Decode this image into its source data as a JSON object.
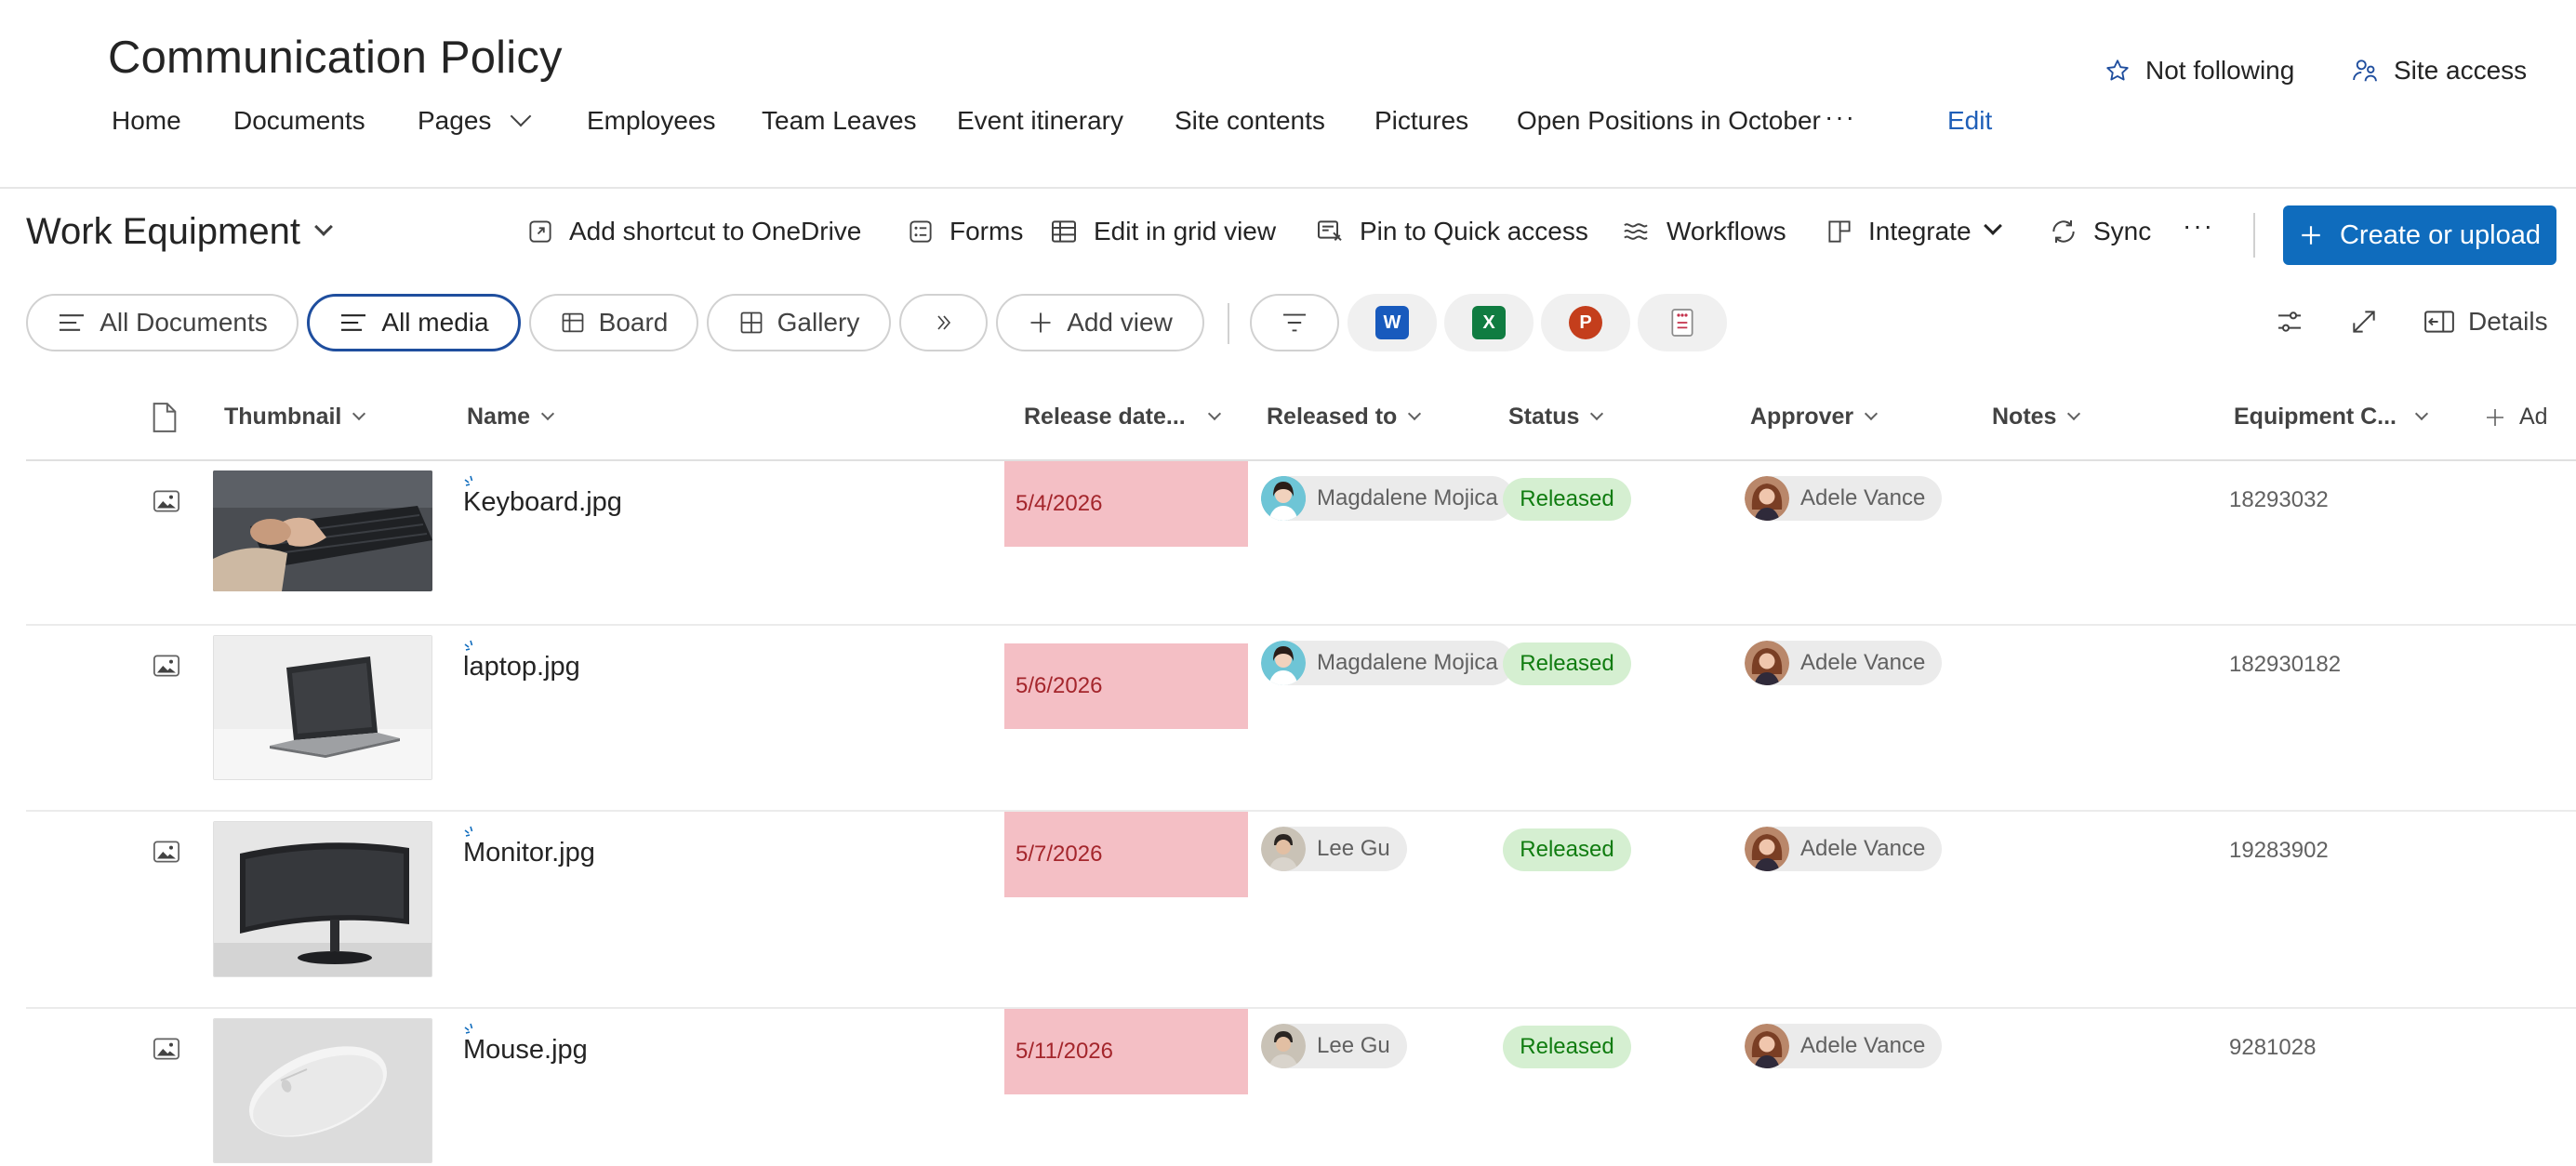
{
  "site": {
    "title": "Communication Policy",
    "nav": [
      "Home",
      "Documents",
      "Pages",
      "Employees",
      "Team Leaves",
      "Event itinerary",
      "Site contents",
      "Pictures",
      "Open Positions in October",
      "···",
      "Edit"
    ],
    "follow_label": "Not following",
    "access_label": "Site access"
  },
  "library": {
    "title": "Work Equipment",
    "commands": {
      "shortcut": "Add shortcut to OneDrive",
      "forms": "Forms",
      "grid": "Edit in grid view",
      "pin": "Pin to Quick access",
      "workflows": "Workflows",
      "integrate": "Integrate",
      "sync": "Sync",
      "more": "···",
      "create": "Create or upload"
    }
  },
  "views": {
    "all_documents": "All Documents",
    "all_media": "All media",
    "board": "Board",
    "gallery": "Gallery",
    "add_view": "Add view",
    "details": "Details"
  },
  "columns": {
    "thumbnail": "Thumbnail",
    "name": "Name",
    "release_date": "Release date...",
    "released_to": "Released to",
    "status": "Status",
    "approver": "Approver",
    "notes": "Notes",
    "equipment": "Equipment C...",
    "add_column": "Ad"
  },
  "rows": [
    {
      "name": "Keyboard.jpg",
      "release_date": "5/4/2026",
      "released_to": "Magdalene Mojica",
      "status": "Released",
      "approver": "Adele Vance",
      "equipment": "18293032"
    },
    {
      "name": "laptop.jpg",
      "release_date": "5/6/2026",
      "released_to": "Magdalene Mojica",
      "status": "Released",
      "approver": "Adele Vance",
      "equipment": "182930182"
    },
    {
      "name": "Monitor.jpg",
      "release_date": "5/7/2026",
      "released_to": "Lee Gu",
      "status": "Released",
      "approver": "Adele Vance",
      "equipment": "19283902"
    },
    {
      "name": "Mouse.jpg",
      "release_date": "5/11/2026",
      "released_to": "Lee Gu",
      "status": "Released",
      "approver": "Adele Vance",
      "equipment": "9281028"
    }
  ],
  "colors": {
    "accent": "#0f6cbd",
    "date_highlight": "#f4bfc5",
    "status_bg": "#d5efd1",
    "status_text": "#107c10"
  }
}
